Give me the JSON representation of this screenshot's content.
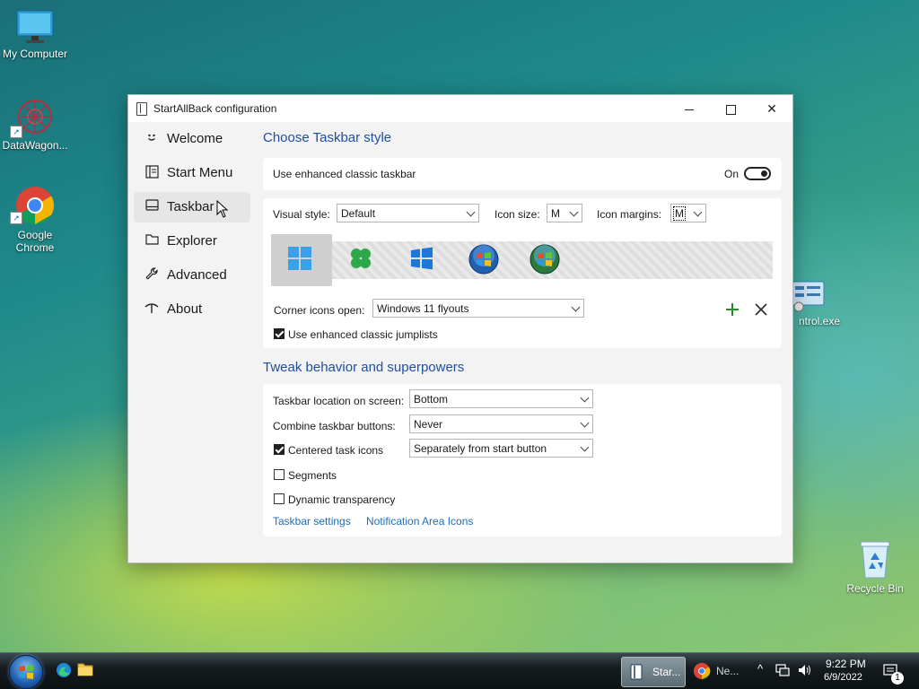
{
  "desktop": {
    "icons": [
      {
        "label": "My Computer"
      },
      {
        "label": "DataWagon..."
      },
      {
        "label": "Google Chrome"
      },
      {
        "label": "ntrol.exe"
      },
      {
        "label": "Recycle Bin"
      }
    ]
  },
  "window": {
    "title": "StartAllBack configuration",
    "sidebar": [
      {
        "label": "Welcome",
        "icon": "smiley-icon"
      },
      {
        "label": "Start Menu",
        "icon": "start-menu-icon"
      },
      {
        "label": "Taskbar",
        "icon": "taskbar-icon",
        "active": true
      },
      {
        "label": "Explorer",
        "icon": "folder-icon"
      },
      {
        "label": "Advanced",
        "icon": "wrench-icon"
      },
      {
        "label": "About",
        "icon": "about-icon"
      }
    ],
    "choose": {
      "title": "Choose Taskbar style",
      "enhanced_label": "Use enhanced classic taskbar",
      "toggle_state": "On",
      "visual_style_label": "Visual style:",
      "visual_style_value": "Default",
      "icon_size_label": "Icon size:",
      "icon_size_value": "M",
      "icon_margins_label": "Icon margins:",
      "icon_margins_value": "M",
      "styles": [
        "windows-11",
        "clover",
        "windows-10",
        "windows-7-orb",
        "windows-vista-orb"
      ],
      "corner_label": "Corner icons open:",
      "corner_value": "Windows 11 flyouts",
      "jumplists_label": "Use enhanced classic jumplists",
      "jumplists_checked": true
    },
    "tweak": {
      "title": "Tweak behavior and superpowers",
      "location_label": "Taskbar location on screen:",
      "location_value": "Bottom",
      "combine_label": "Combine taskbar buttons:",
      "combine_value": "Never",
      "centered_label": "Centered task icons",
      "centered_checked": true,
      "centered_value": "Separately from start button",
      "segments_label": "Segments",
      "segments_checked": false,
      "dynamic_label": "Dynamic transparency",
      "dynamic_checked": false,
      "link_taskbar_settings": "Taskbar settings",
      "link_notification_icons": "Notification Area Icons"
    }
  },
  "taskbar": {
    "buttons": [
      {
        "label": "Star...",
        "active": true
      },
      {
        "label": "Ne..."
      }
    ],
    "time": "9:22 PM",
    "date": "6/9/2022",
    "notification_count": "1"
  },
  "colors": {
    "accent_blue": "#1e4fa0",
    "link": "#1e6cb8",
    "green_plus": "#2a8a2a"
  }
}
